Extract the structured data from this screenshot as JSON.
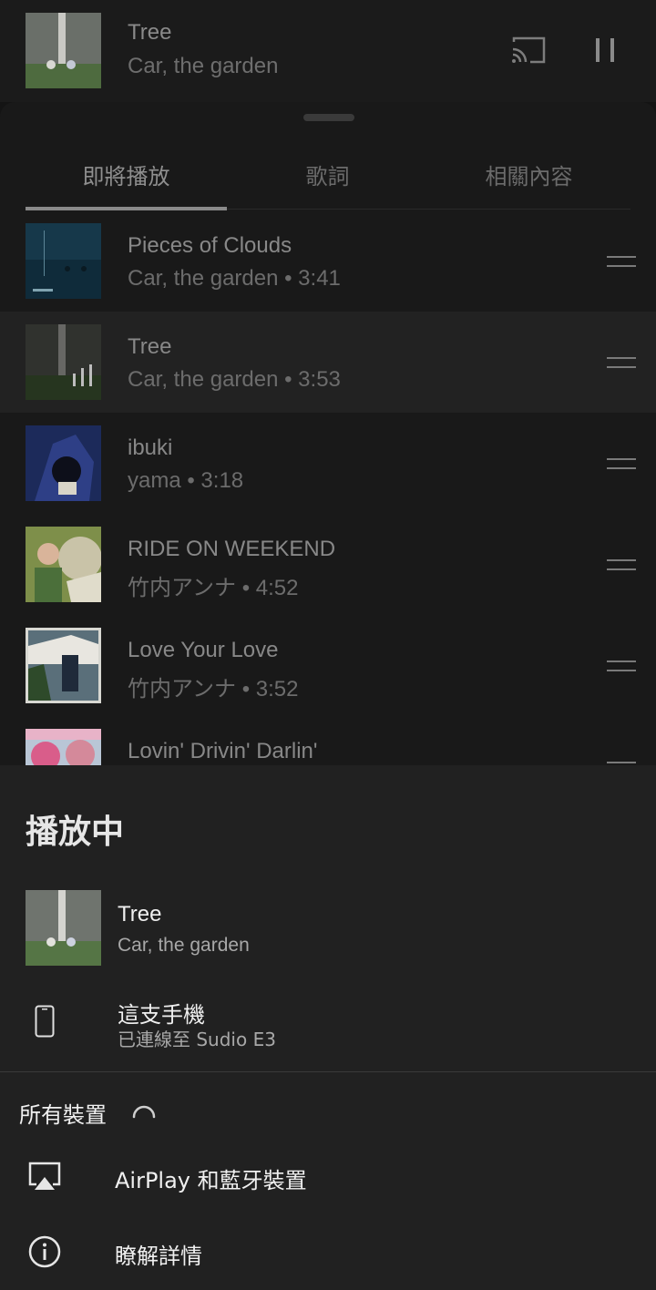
{
  "mini_player": {
    "title": "Tree",
    "artist": "Car, the garden",
    "cast_icon": "cast-icon",
    "pause_icon": "pause-icon"
  },
  "tabs": [
    {
      "label": "即將播放",
      "active": true
    },
    {
      "label": "歌詞",
      "active": false
    },
    {
      "label": "相關內容",
      "active": false
    }
  ],
  "queue": [
    {
      "title": "Pieces of Clouds",
      "subtitle": "Car, the garden • 3:41",
      "current": false
    },
    {
      "title": "Tree",
      "subtitle": "Car, the garden • 3:53",
      "current": true
    },
    {
      "title": "ibuki",
      "subtitle": "yama • 3:18",
      "current": false
    },
    {
      "title": "RIDE ON WEEKEND",
      "subtitle": "竹内アンナ • 4:52",
      "current": false
    },
    {
      "title": "Love Your Love",
      "subtitle": "竹内アンナ • 3:52",
      "current": false
    },
    {
      "title": "Lovin' Drivin' Darlin'",
      "subtitle": "",
      "current": false
    }
  ],
  "output_panel": {
    "heading": "播放中",
    "now_playing": {
      "title": "Tree",
      "artist": "Car, the garden"
    },
    "device": {
      "name": "這支手機",
      "status": "已連線至 Sudio E3"
    },
    "all_devices_label": "所有裝置",
    "airplay_label": "AirPlay 和藍牙裝置",
    "learn_more_label": "瞭解詳情"
  },
  "colors": {
    "background": "#141414",
    "panel": "#212121",
    "current_row": "#222222"
  }
}
